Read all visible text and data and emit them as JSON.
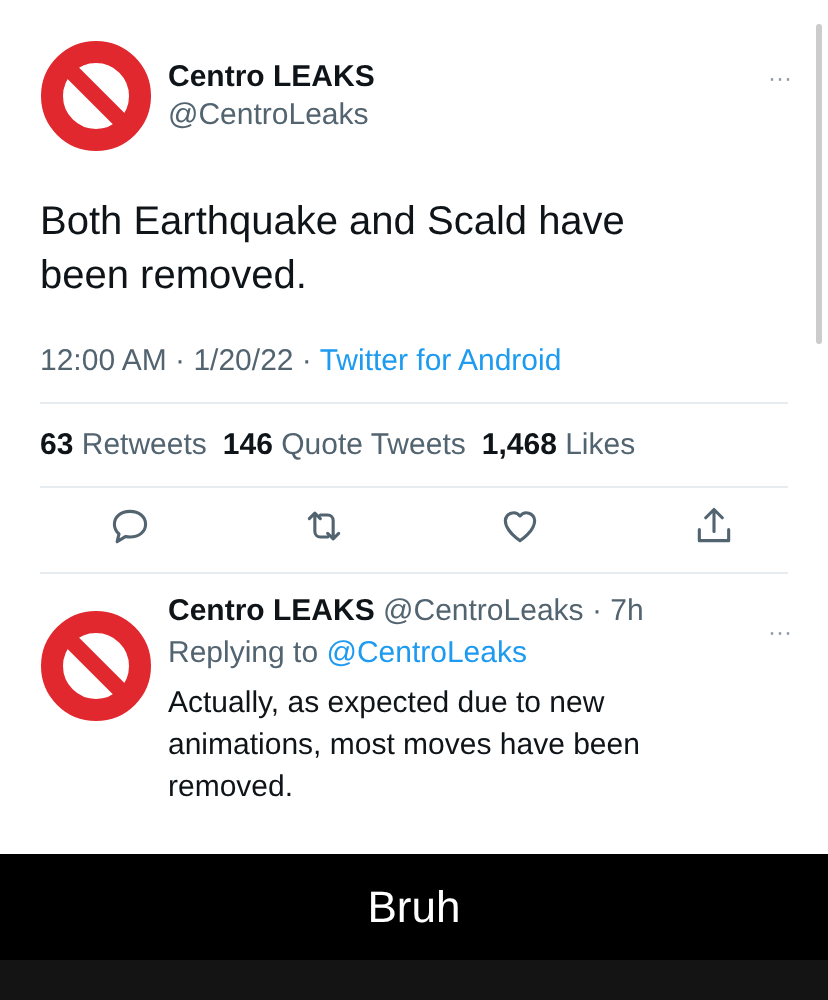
{
  "tweet": {
    "name": "Centro LEAKS",
    "handle": "@CentroLeaks",
    "more": "···",
    "text": "Both Earthquake and Scald have been removed.",
    "time": "12:00 AM · 1/20/22 · ",
    "source": "Twitter for Android",
    "stats": [
      {
        "count": "63",
        "label": "Retweets"
      },
      {
        "count": "146",
        "label": "Quote Tweets"
      },
      {
        "count": "1,468",
        "label": "Likes"
      }
    ]
  },
  "actions": [
    {
      "kind": "reply"
    },
    {
      "kind": "retweet"
    },
    {
      "kind": "like"
    },
    {
      "kind": "share"
    }
  ],
  "reply": {
    "name": "Centro LEAKS",
    "meta": "@CentroLeaks · 7h",
    "more": "···",
    "replying": "Replying to ",
    "replying_to": "@CentroLeaks",
    "text": "Actually, as expected due to new animations, most moves have been removed."
  },
  "caption": "Bruh"
}
